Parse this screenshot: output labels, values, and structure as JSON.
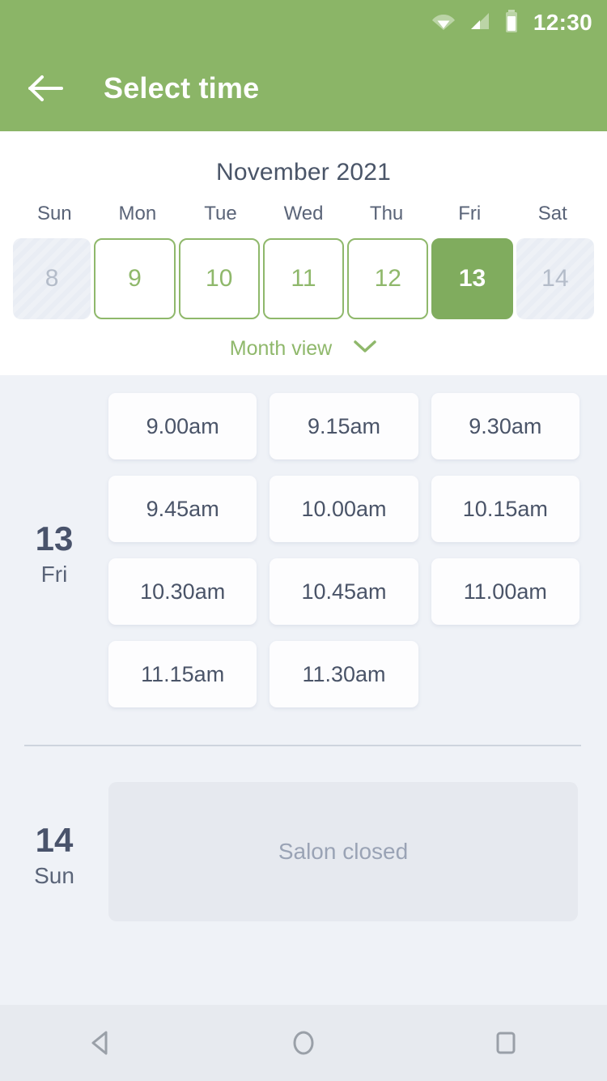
{
  "status_bar": {
    "time": "12:30",
    "icons": [
      "wifi-icon",
      "cellular-signal-icon",
      "battery-icon"
    ]
  },
  "app_bar": {
    "title": "Select time",
    "back_icon": "back-arrow-icon"
  },
  "calendar": {
    "month_label": "November 2021",
    "day_names": [
      "Sun",
      "Mon",
      "Tue",
      "Wed",
      "Thu",
      "Fri",
      "Sat"
    ],
    "days": [
      {
        "number": "8",
        "state": "disabled"
      },
      {
        "number": "9",
        "state": "available"
      },
      {
        "number": "10",
        "state": "available"
      },
      {
        "number": "11",
        "state": "available"
      },
      {
        "number": "12",
        "state": "available"
      },
      {
        "number": "13",
        "state": "selected"
      },
      {
        "number": "14",
        "state": "disabled"
      }
    ],
    "month_view_label": "Month view",
    "month_view_icon": "chevron-down-icon"
  },
  "schedule": {
    "groups": [
      {
        "day_number": "13",
        "day_name": "Fri",
        "type": "slots",
        "slots": [
          "9.00am",
          "9.15am",
          "9.30am",
          "9.45am",
          "10.00am",
          "10.15am",
          "10.30am",
          "10.45am",
          "11.00am",
          "11.15am",
          "11.30am"
        ]
      },
      {
        "day_number": "14",
        "day_name": "Sun",
        "type": "closed",
        "closed_label": "Salon closed"
      }
    ]
  },
  "nav_bar": {
    "back": "nav-back-icon",
    "home": "nav-home-icon",
    "recents": "nav-recents-icon"
  },
  "colors": {
    "brand_green": "#8bb567",
    "selected_green": "#80ac5e",
    "background": "#eff2f7",
    "text_dark": "#4a5568",
    "closed_card": "#e6e9ef"
  }
}
